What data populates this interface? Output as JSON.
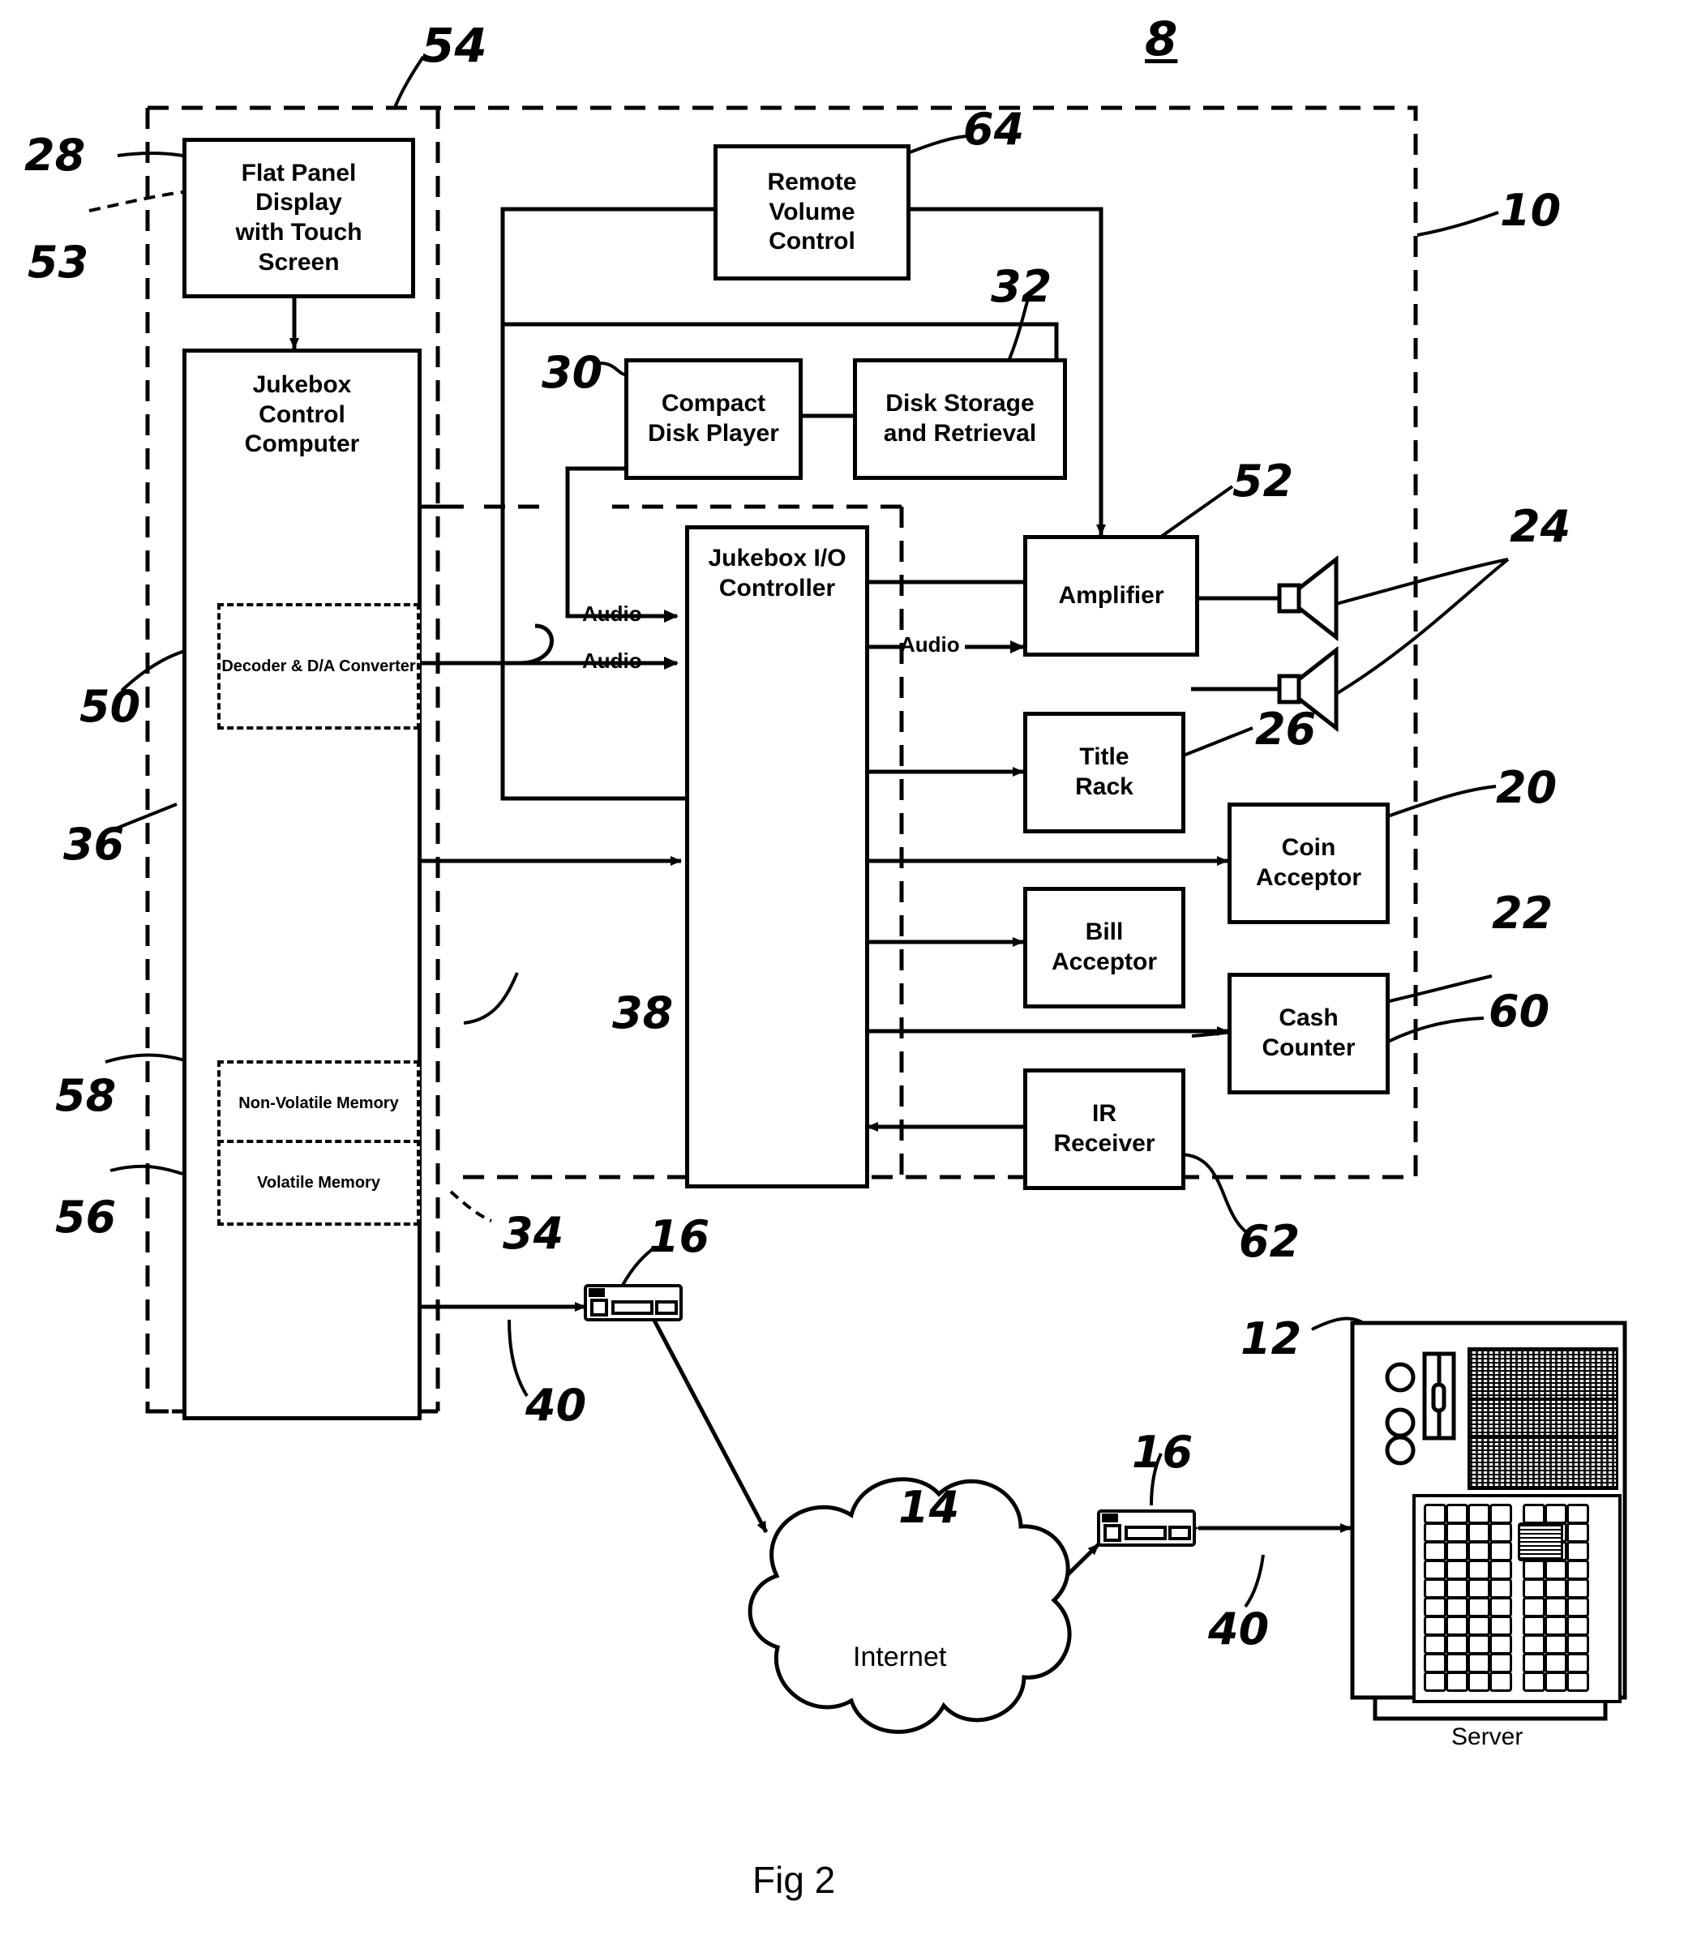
{
  "figure": {
    "caption": "Fig 2",
    "system_ref": "8",
    "jukebox_ref": "10"
  },
  "blocks": {
    "flat_panel_display": {
      "line1": "Flat Panel",
      "line2": "Display",
      "line3": "with Touch",
      "line4": "Screen"
    },
    "jukebox_control_computer": {
      "line1": "Jukebox",
      "line2": "Control",
      "line3": "Computer"
    },
    "decoder_da_converter": {
      "line1": "Decoder &",
      "line2": "D/A Converter"
    },
    "non_volatile_memory": {
      "label": "Non-Volatile Memory"
    },
    "volatile_memory": {
      "label": "Volatile Memory"
    },
    "remote_volume_control": {
      "line1": "Remote",
      "line2": "Volume",
      "line3": "Control"
    },
    "compact_disk_player": {
      "line1": "Compact",
      "line2": "Disk Player"
    },
    "disk_storage_retrieval": {
      "line1": "Disk Storage",
      "line2": "and Retrieval"
    },
    "jukebox_io_controller": {
      "line1": "Jukebox I/O",
      "line2": "Controller"
    },
    "amplifier": {
      "label": "Amplifier"
    },
    "title_rack": {
      "line1": "Title",
      "line2": "Rack"
    },
    "coin_acceptor": {
      "line1": "Coin",
      "line2": "Acceptor"
    },
    "bill_acceptor": {
      "line1": "Bill",
      "line2": "Acceptor"
    },
    "cash_counter": {
      "line1": "Cash",
      "line2": "Counter"
    },
    "ir_receiver": {
      "line1": "IR",
      "line2": "Receiver"
    },
    "internet_cloud": {
      "label": "Internet"
    },
    "server": {
      "label": "Server"
    }
  },
  "signal_labels": {
    "audio_cd_to_io": "Audio",
    "audio_decoder_to_io": "Audio",
    "audio_io_to_amp": "Audio"
  },
  "reference_numerals": {
    "n8": "8",
    "n10": "10",
    "n12": "12",
    "n14": "14",
    "n16_left": "16",
    "n16_right": "16",
    "n20": "20",
    "n22": "22",
    "n24": "24",
    "n26": "26",
    "n28": "28",
    "n30": "30",
    "n32": "32",
    "n34": "34",
    "n36": "36",
    "n38": "38",
    "n40_left": "40",
    "n40_right": "40",
    "n50": "50",
    "n52": "52",
    "n53": "53",
    "n54": "54",
    "n56": "56",
    "n58": "58",
    "n60": "60",
    "n62": "62",
    "n64": "64"
  },
  "icons": {
    "speaker_top": "speaker-icon",
    "speaker_bottom": "speaker-icon",
    "router_left": "network-hub-icon",
    "router_right": "network-hub-icon",
    "cloud": "cloud-icon",
    "server_tower": "server-tower-icon"
  },
  "colors": {
    "line": "#000000",
    "background": "#ffffff"
  }
}
